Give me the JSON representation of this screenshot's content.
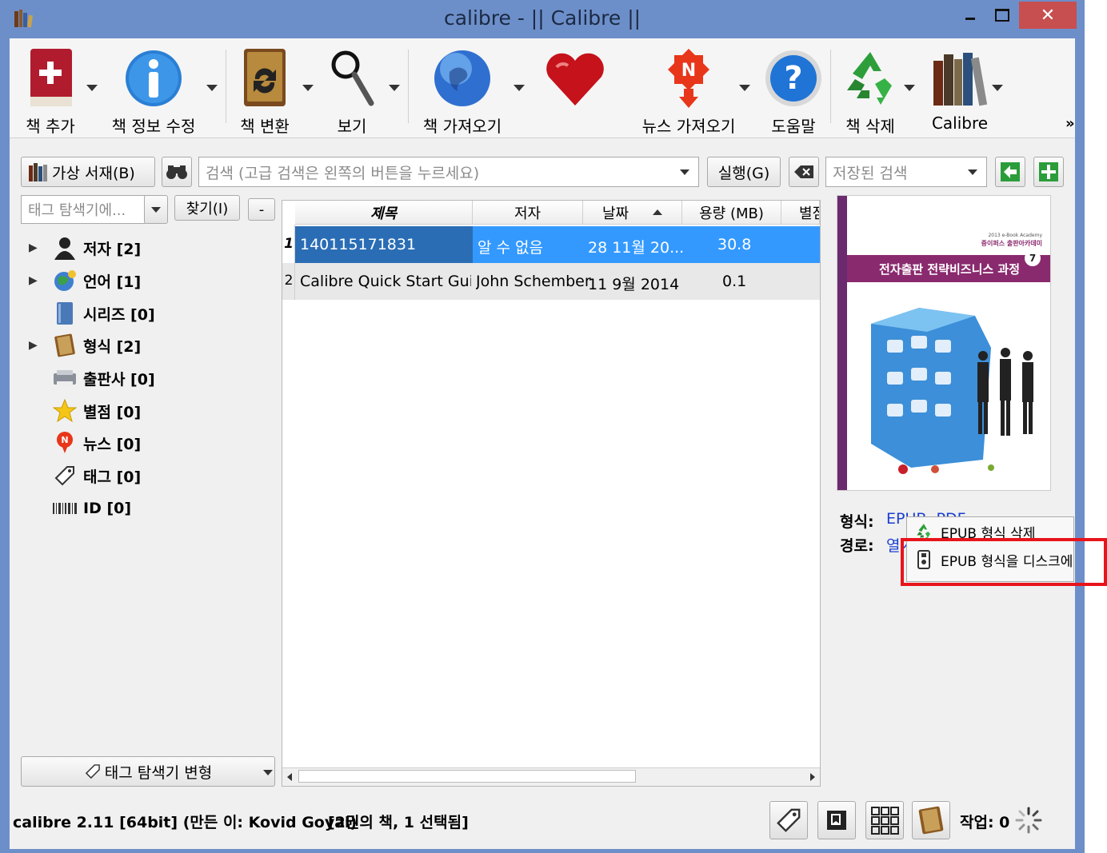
{
  "window": {
    "title": "calibre - || Calibre ||",
    "minimize": "—",
    "maximize": "□",
    "close": "✕"
  },
  "toolbar": {
    "add_books": "책 추가",
    "edit_metadata": "책 정보 수정",
    "convert": "책 변환",
    "view": "보기",
    "get_books": "책 가져오기",
    "fetch_news": "뉴스 가져오기",
    "help": "도움말",
    "remove_books": "책 삭제",
    "calibre_library": "Calibre",
    "more": "»"
  },
  "searchbar": {
    "virtual_library": "가상 서재(B)",
    "search_placeholder": "검색 (고급 검색은 왼쪽의 버튼을 누르세요)",
    "go_button": "실행(G)",
    "saved_search_placeholder": "저장된 검색"
  },
  "tag_browser": {
    "filter_placeholder": "태그 탐색기에...",
    "find_button": "찾기(I)",
    "collapse_button": "-",
    "items": [
      {
        "label": "저자 [2]"
      },
      {
        "label": "언어 [1]"
      },
      {
        "label": "시리즈 [0]"
      },
      {
        "label": "형식 [2]"
      },
      {
        "label": "출판사 [0]"
      },
      {
        "label": "별점 [0]"
      },
      {
        "label": "뉴스 [0]"
      },
      {
        "label": "태그 [0]"
      },
      {
        "label": "ID [0]"
      }
    ],
    "alter_button": "태그 탐색기 변형"
  },
  "book_table": {
    "columns": [
      "제목",
      "저자",
      "날짜",
      "용량 (MB)",
      "별점"
    ],
    "rows": [
      {
        "num": "1",
        "title": "140115171831",
        "author": "알 수 없음",
        "date": "28 11월 20...",
        "size": "30.8"
      },
      {
        "num": "2",
        "title": "Calibre Quick Start Guide",
        "author": "John Schember",
        "date": "11  9월 2014",
        "size": "0.1"
      }
    ]
  },
  "book_details": {
    "formats_label": "형식:",
    "formats_value": "EPUB, PDF",
    "path_label": "경로:",
    "path_value": "열기",
    "cover": {
      "top_text": "2013 e-Book Academy",
      "academy": "중이퍼스 출판아카데미",
      "title": "전자출판 전략비즈니스 과정",
      "number": "7"
    }
  },
  "context_menu": {
    "items": [
      {
        "label": "EPUB 형식 삭제"
      },
      {
        "label": "EPUB 형식을 디스크에"
      }
    ]
  },
  "statusbar": {
    "version": "calibre 2.11 [64bit] (만든 이: Kovid Goyal)",
    "selection": "[2권의 책, 1 선택됨]",
    "jobs": "작업: 0"
  },
  "colors": {
    "titlebar": "#6d8fc9",
    "selection": "#3399ff",
    "highlight_box": "#e8141b"
  }
}
